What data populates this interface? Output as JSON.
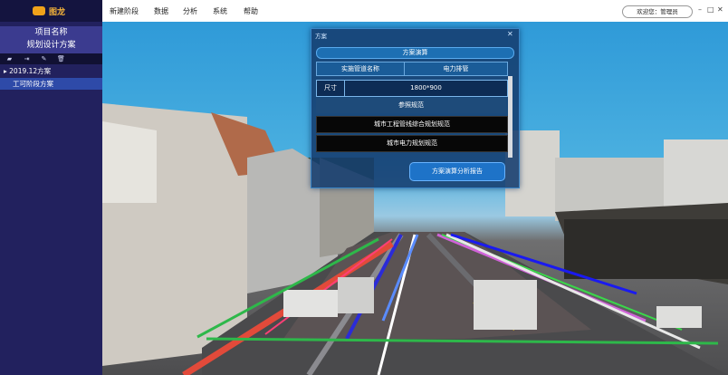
{
  "sidebar": {
    "logo_text": "图龙",
    "project_title_line1": "项目名称",
    "project_title_line2": "规划设计方案",
    "tools": [
      {
        "name": "open-folder-icon",
        "glyph": "▰"
      },
      {
        "name": "export-icon",
        "glyph": "⇥"
      },
      {
        "name": "edit-icon",
        "glyph": "✎"
      },
      {
        "name": "delete-icon",
        "glyph": "🗑"
      }
    ],
    "tree_plan": "▸ 2019.12方案",
    "tree_stage": "工可阶段方案"
  },
  "menu": {
    "items": [
      "新建阶段",
      "数据",
      "分析",
      "系统",
      "帮助"
    ],
    "welcome": "欢迎您：管理员",
    "window_buttons": [
      "–",
      "□",
      "✕"
    ]
  },
  "dialog": {
    "title": "方案",
    "close": "✕",
    "header": "方案演算",
    "col_name": "实施管道名称",
    "col_type": "电力排管",
    "size_label": "尺寸",
    "size_value": "1800*900",
    "ref_label": "参照规范",
    "standards": [
      "城市工程管线综合规划规范",
      "城市电力规划规范"
    ],
    "button": "方案演算分析报告"
  }
}
